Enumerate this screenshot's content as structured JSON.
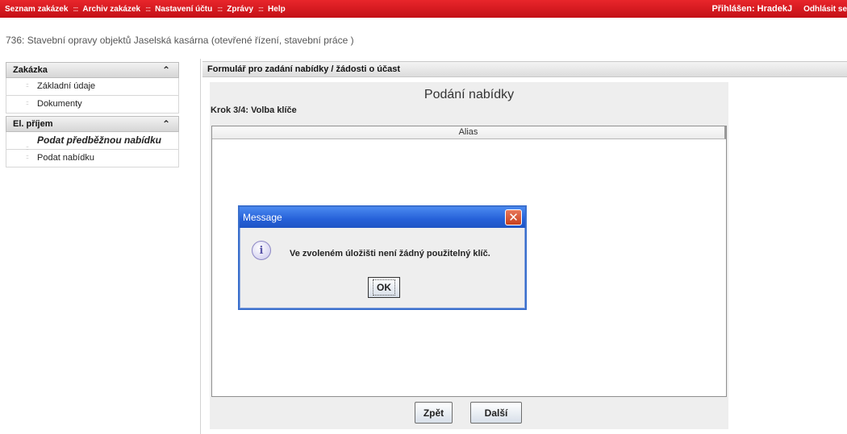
{
  "topbar": {
    "nav": [
      {
        "label": "Seznam zakázek"
      },
      {
        "label": "Archiv zakázek"
      },
      {
        "label": "Nastavení účtu"
      },
      {
        "label": "Zprávy"
      },
      {
        "label": "Help"
      }
    ],
    "separator": ":::",
    "logged_in": "Přihlášen: HradekJ",
    "logout": "Odhlásit se"
  },
  "tender": {
    "title": "736: Stavební opravy objektů Jaselská kasárna (otevřené řízení, stavební práce )"
  },
  "sidebar": {
    "sections": [
      {
        "title": "Zakázka",
        "items": [
          {
            "label": "Základní údaje"
          },
          {
            "label": "Dokumenty"
          }
        ]
      },
      {
        "title": "El. příjem",
        "items": [
          {
            "label": "Podat předběžnou nabídku"
          },
          {
            "label": "Podat nabídku"
          }
        ]
      }
    ]
  },
  "main": {
    "header": "Formulář pro zadání nabídky / žádosti o účast",
    "applet": {
      "title": "Podání nabídky",
      "step": "Krok 3/4: Volba klíče",
      "table": {
        "columns": [
          "Alias"
        ]
      },
      "back_label": "Zpět",
      "next_label": "Další"
    }
  },
  "dialog": {
    "title": "Message",
    "message": "Ve zvoleném úložišti není žádný použitelný klíč.",
    "ok_label": "OK",
    "icon": "information-icon"
  }
}
